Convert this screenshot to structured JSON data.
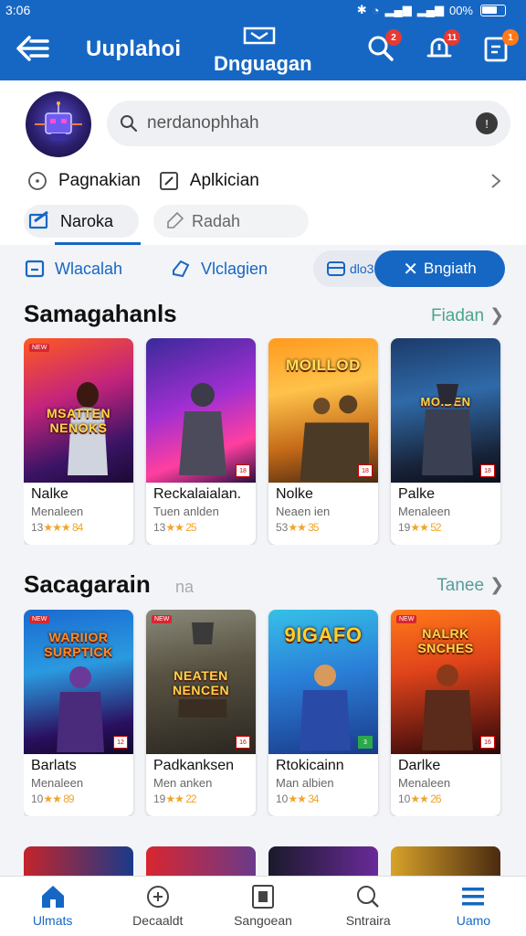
{
  "status_bar": {
    "time": "3:06",
    "battery": "00%"
  },
  "header": {
    "title_left": "Uuplahoi",
    "title_center": "Dnguagan",
    "badges": {
      "search": "2",
      "bell": "11",
      "clipboard": "1"
    },
    "colors": {
      "primary": "#1667c4"
    }
  },
  "search": {
    "placeholder": "nerdanophhah"
  },
  "quick_row": {
    "item1": "Pagnakian",
    "item2": "Aplkician"
  },
  "chips": {
    "chip1": "Naroka",
    "chip2": "Radah"
  },
  "tabs": {
    "tab1": "Wlacalah",
    "tab2": "Vlclagien",
    "pill": "dlo3",
    "close": "Bngiath"
  },
  "sections": [
    {
      "title": "Samagahanls",
      "link": "Fiadan",
      "cards": [
        {
          "name": "Nalke",
          "dev": "Menaleen",
          "rating": "★★★ 84",
          "prefix": "13",
          "art_text": "MSATTEN NENOKS"
        },
        {
          "name": "Reckalaialan.",
          "dev": "Tuen anlden",
          "rating": "★★ 25",
          "prefix": "13",
          "art_text": ""
        },
        {
          "name": "Nolke",
          "dev": "Neaen ien",
          "rating": "★★ 35",
          "prefix": "53",
          "art_text": "MOILLOD"
        },
        {
          "name": "Palke",
          "dev": "Menaleen",
          "rating": "★★ 52",
          "prefix": "19",
          "art_text": "MOIDEN"
        }
      ]
    },
    {
      "title": "Sacagarain",
      "subtitle": "na",
      "link": "Tanee",
      "cards": [
        {
          "name": "Barlats",
          "dev": "Menaleen",
          "rating": "★★ 89",
          "prefix": "10",
          "art_text": "WARIIOR SURPTICK"
        },
        {
          "name": "Padkanksen",
          "dev": "Men anken",
          "rating": "★★ 22",
          "prefix": "19",
          "art_text": "NEATEN NENCEN"
        },
        {
          "name": "Rtokicainn",
          "dev": "Man albien",
          "rating": "★★ 34",
          "prefix": "10",
          "art_text": "9IGAFO"
        },
        {
          "name": "Darlke",
          "dev": "Menaleen",
          "rating": "★★ 26",
          "prefix": "10",
          "art_text": "NALRK SNCHES"
        }
      ]
    }
  ],
  "bottom_nav": [
    {
      "label": "Ulmats",
      "icon": "home-icon",
      "active": true
    },
    {
      "label": "Decaaldt",
      "icon": "games-icon",
      "active": false
    },
    {
      "label": "Sangoean",
      "icon": "apps-icon",
      "active": false
    },
    {
      "label": "Sntraira",
      "icon": "search-icon",
      "active": false
    },
    {
      "label": "Uamo",
      "icon": "menu-icon",
      "active": true
    }
  ]
}
